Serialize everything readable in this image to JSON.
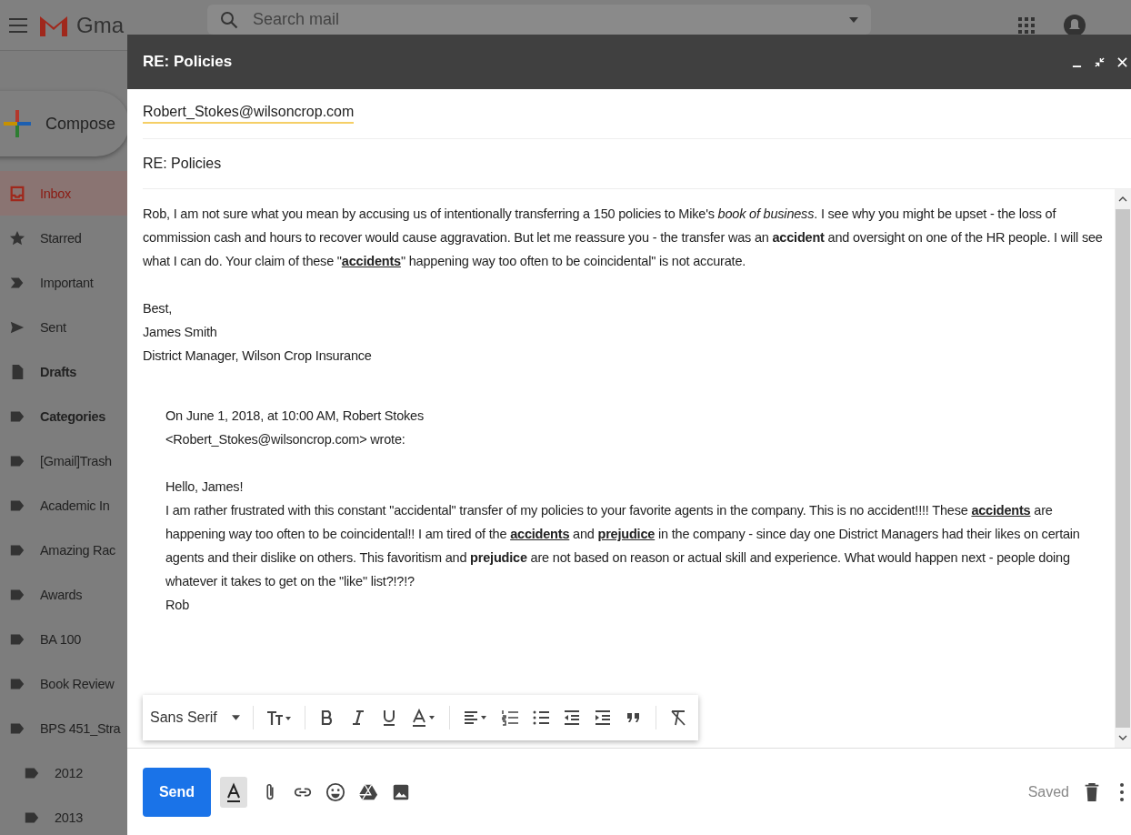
{
  "app": {
    "logo_text": "Gma",
    "search": {
      "placeholder": "Search mail"
    }
  },
  "compose_button": "Compose",
  "sidebar": {
    "items": [
      {
        "label": "Inbox",
        "kind": "inbox",
        "selected": true,
        "bold": false
      },
      {
        "label": "Starred",
        "kind": "star",
        "selected": false,
        "bold": false
      },
      {
        "label": "Important",
        "kind": "important",
        "selected": false,
        "bold": false
      },
      {
        "label": "Sent",
        "kind": "sent",
        "selected": false,
        "bold": false
      },
      {
        "label": "Drafts",
        "kind": "draft",
        "selected": false,
        "bold": true
      },
      {
        "label": "Categories",
        "kind": "label",
        "selected": false,
        "bold": true
      },
      {
        "label": "[Gmail]Trash",
        "kind": "label",
        "selected": false,
        "bold": false
      },
      {
        "label": "Academic In",
        "kind": "label",
        "selected": false,
        "bold": false
      },
      {
        "label": "Amazing Rac",
        "kind": "label",
        "selected": false,
        "bold": false
      },
      {
        "label": "Awards",
        "kind": "label",
        "selected": false,
        "bold": false
      },
      {
        "label": "BA 100",
        "kind": "label",
        "selected": false,
        "bold": false
      },
      {
        "label": "Book Review",
        "kind": "label",
        "selected": false,
        "bold": false
      },
      {
        "label": "BPS 451_Stra",
        "kind": "label",
        "selected": false,
        "bold": false,
        "children": [
          {
            "label": "2012",
            "kind": "label",
            "selected": false,
            "bold": false
          },
          {
            "label": "2013",
            "kind": "label",
            "selected": false,
            "bold": false
          }
        ]
      }
    ]
  },
  "compose": {
    "title": "RE: Policies",
    "to": "Robert_Stokes@wilsoncrop.com",
    "subject": "RE: Policies",
    "reply": [
      {
        "text": "Rob, I am not sure what you mean by accusing us of intentionally transferring a 150 policies to Mike's ",
        "kind": "plain"
      },
      {
        "text": "book of business",
        "kind": "italic"
      },
      {
        "text": ". I see why you might be upset - the loss of commission cash and hours to recover would cause aggravation. But let me reassure you - the transfer was an ",
        "kind": "plain"
      },
      {
        "text": "accident",
        "kind": "bold"
      },
      {
        "text": " and oversight on one of the HR people. I will see what I can do. Your claim of these \"",
        "kind": "plain"
      },
      {
        "text": "accidents",
        "kind": "bold_underline"
      },
      {
        "text": "\" happening way too often to be coincidental\" is not accurate.",
        "kind": "plain"
      }
    ],
    "signature": [
      "Best,",
      "James Smith",
      "District Manager, Wilson Crop Insurance"
    ],
    "quote": {
      "header": [
        "On June 1, 2018, at 10:00 AM, Robert Stokes",
        "<Robert_Stokes@wilsoncrop.com> wrote:"
      ],
      "greeting": "Hello, James!",
      "paragraph": [
        {
          "text": "I am rather frustrated with this constant \"accidental\" transfer of my policies to your favorite agents in the company. This is no accident!!!!  These ",
          "kind": "plain"
        },
        {
          "text": "accidents",
          "kind": "bold_underline"
        },
        {
          "text": " are happening way too often to be coincidental!! I am tired of the ",
          "kind": "plain"
        },
        {
          "text": "accidents",
          "kind": "bold_underline"
        },
        {
          "text": " and ",
          "kind": "plain"
        },
        {
          "text": "prejudice",
          "kind": "bold_underline"
        },
        {
          "text": " in the company - since day one District Managers had their likes on certain agents and their dislike on others. This favoritism and ",
          "kind": "plain"
        },
        {
          "text": "prejudice",
          "kind": "bold"
        },
        {
          "text": " are not based on reason or actual skill and experience. What would happen next - people doing whatever it takes to get on the \"like\" list?!?!?",
          "kind": "plain"
        }
      ],
      "signoff": "Rob"
    },
    "font_select": "Sans Serif",
    "send": "Send",
    "status": "Saved"
  }
}
